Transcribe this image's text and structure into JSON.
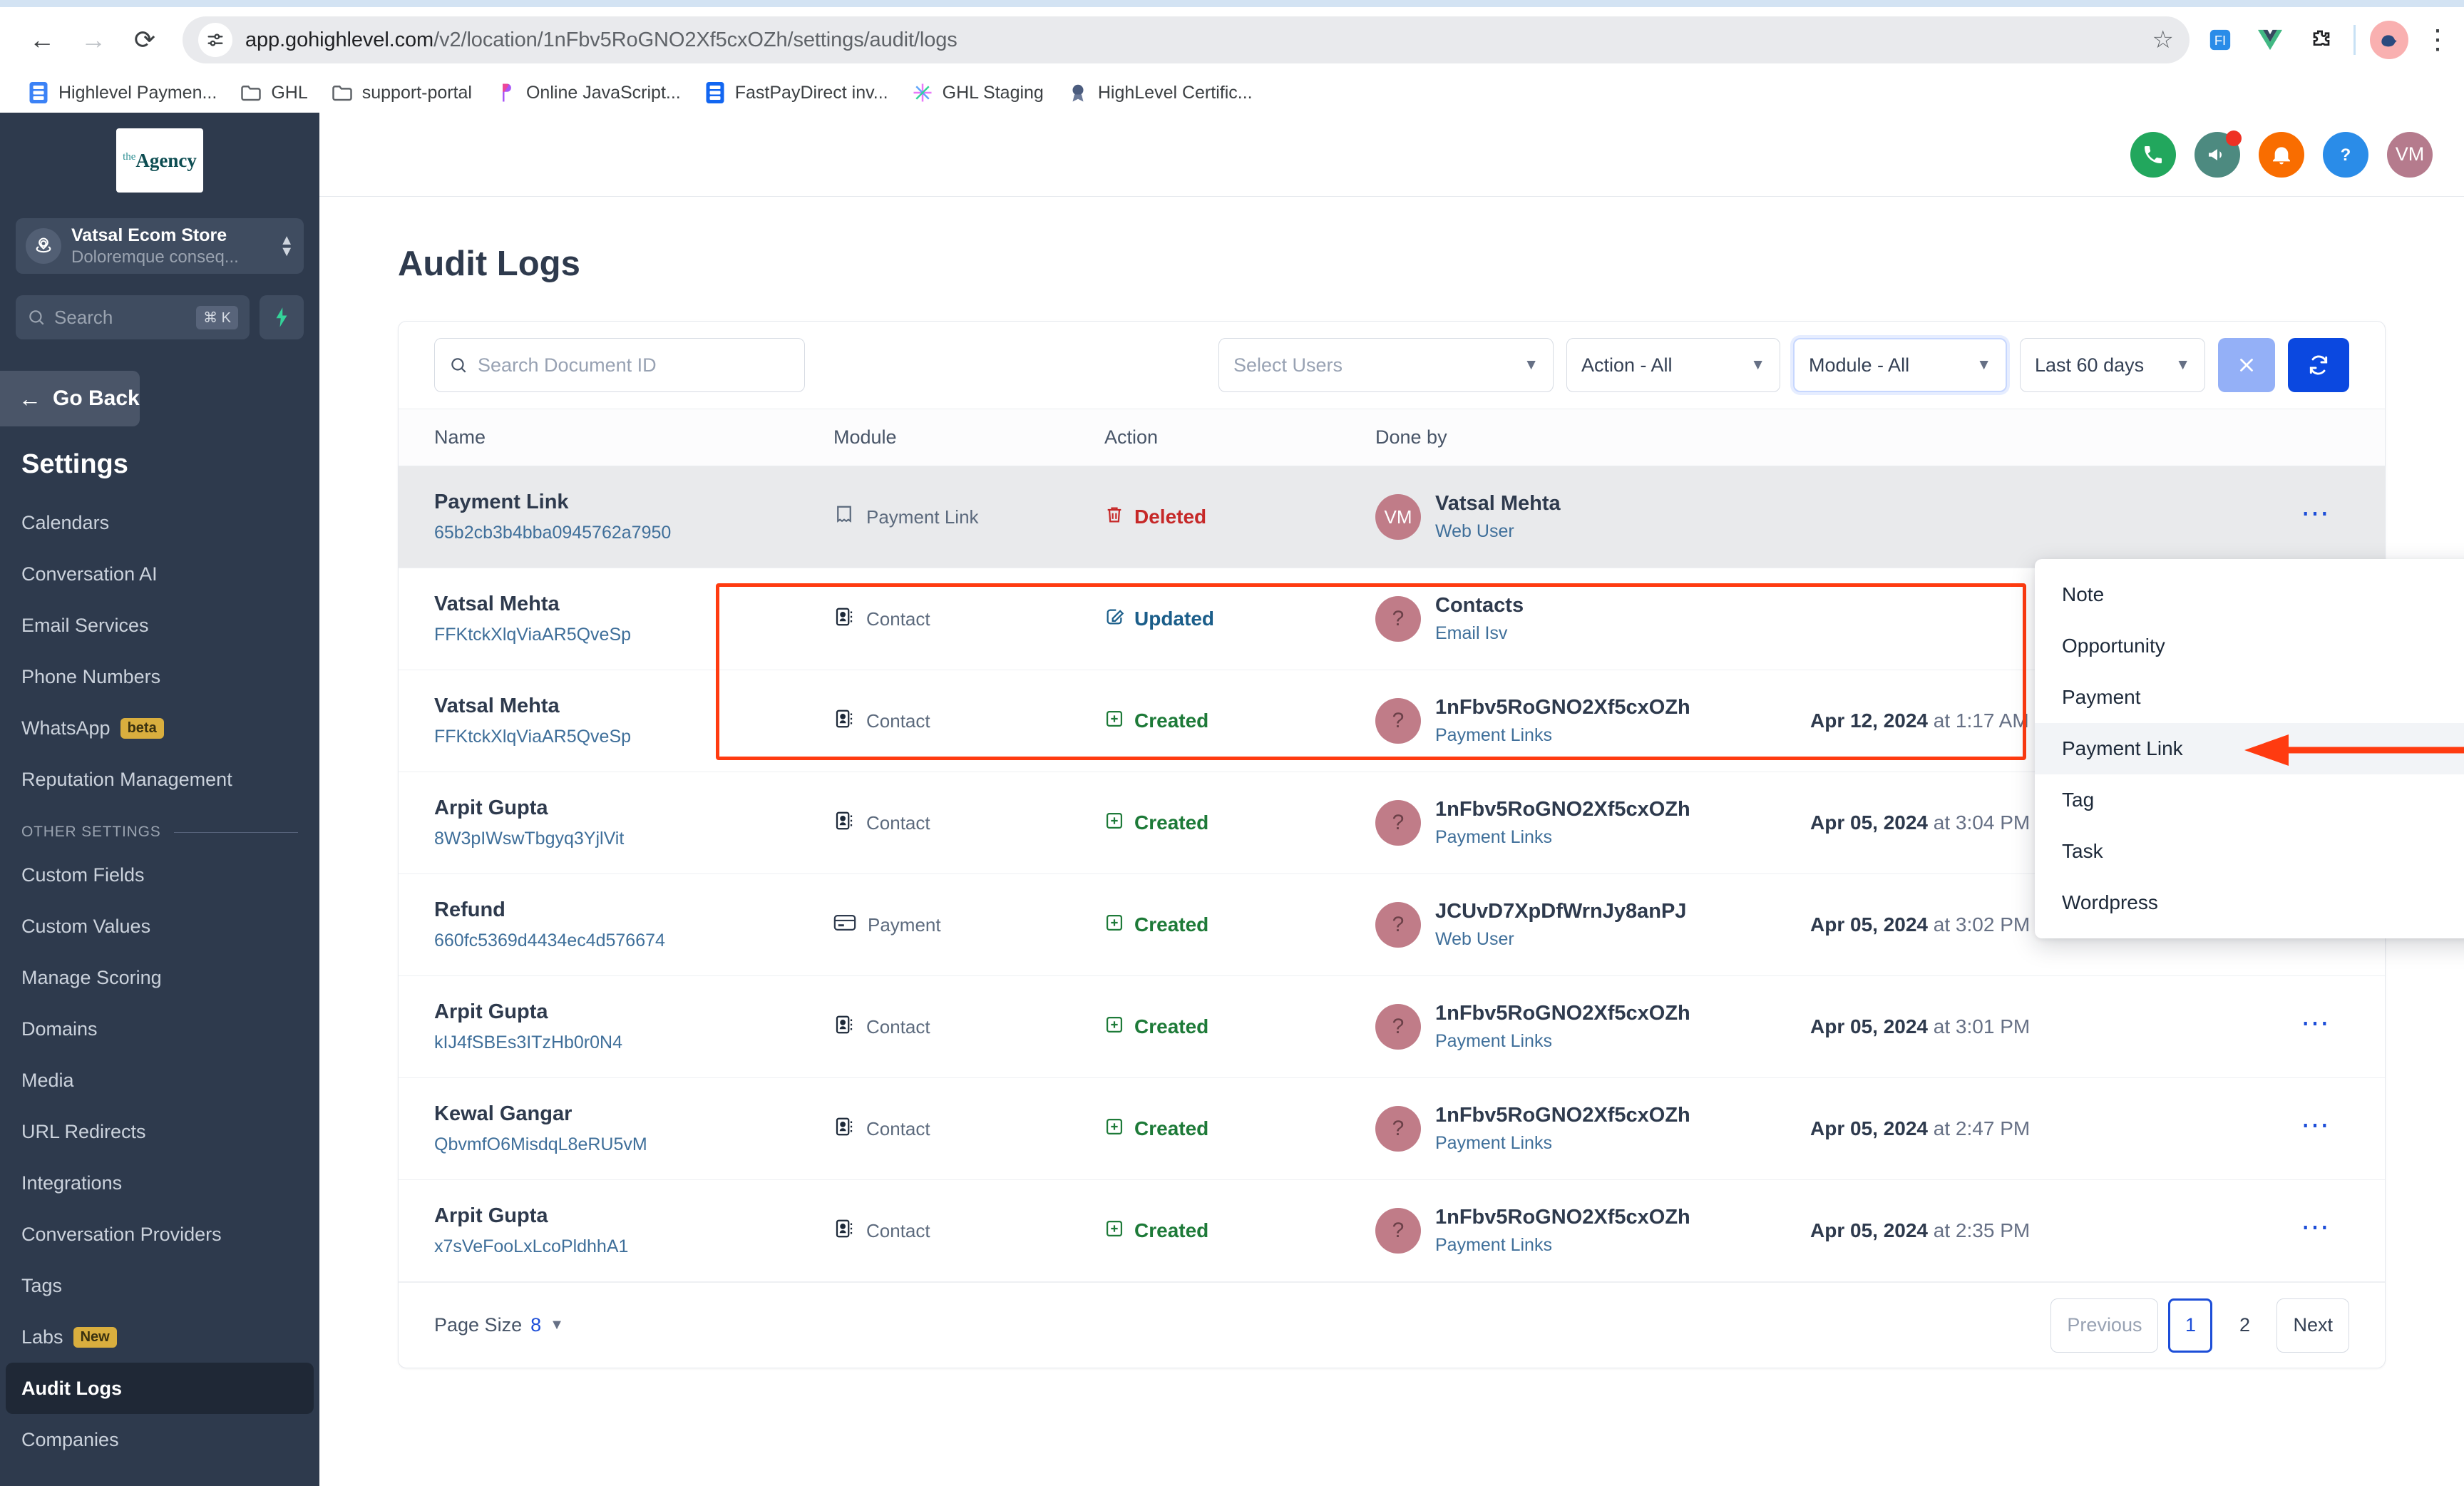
{
  "browser": {
    "back_icon": "back-arrow-icon",
    "forward_icon": "forward-arrow-icon",
    "reload_icon": "reload-icon",
    "url_host": "app.gohighlevel.com",
    "url_path": "/v2/location/1nFbv5RoGNO2Xf5cxOZh/settings/audit/logs",
    "bookmarks": [
      {
        "label": "Highlevel Paymen...",
        "icon": "blue-list-icon"
      },
      {
        "label": "GHL",
        "icon": "folder-icon"
      },
      {
        "label": "support-portal",
        "icon": "folder-icon"
      },
      {
        "label": "Online JavaScript...",
        "icon": "purple-p-icon"
      },
      {
        "label": "FastPayDirect inv...",
        "icon": "blue-list-icon"
      },
      {
        "label": "GHL Staging",
        "icon": "sparkle-icon"
      },
      {
        "label": "HighLevel Certific...",
        "icon": "badge-icon"
      }
    ]
  },
  "sidebar": {
    "logo_the": "the",
    "logo_name": "Agency",
    "location_name": "Vatsal Ecom Store",
    "location_subtitle": "Doloremque conseq...",
    "search_placeholder": "Search",
    "search_shortcut": "⌘ K",
    "go_back_label": "Go Back",
    "settings_heading": "Settings",
    "items": [
      {
        "label": "Calendars"
      },
      {
        "label": "Conversation AI"
      },
      {
        "label": "Email Services"
      },
      {
        "label": "Phone Numbers"
      },
      {
        "label": "WhatsApp",
        "badge": "beta"
      },
      {
        "label": "Reputation Management"
      }
    ],
    "other_section_label": "OTHER SETTINGS",
    "other_items": [
      {
        "label": "Custom Fields"
      },
      {
        "label": "Custom Values"
      },
      {
        "label": "Manage Scoring"
      },
      {
        "label": "Domains"
      },
      {
        "label": "Media"
      },
      {
        "label": "URL Redirects"
      },
      {
        "label": "Integrations"
      },
      {
        "label": "Conversation Providers"
      },
      {
        "label": "Tags"
      },
      {
        "label": "Labs",
        "badge": "New"
      },
      {
        "label": "Audit Logs",
        "active": true
      },
      {
        "label": "Companies"
      }
    ]
  },
  "topbar": {
    "icons": [
      {
        "name": "phone-icon",
        "color": "#22a75d"
      },
      {
        "name": "megaphone-icon",
        "color": "#4d8a80",
        "dot": true
      },
      {
        "name": "bell-icon",
        "color": "#f96d00"
      },
      {
        "name": "help-icon",
        "color": "#2a8ce8"
      }
    ],
    "avatar_initials": "VM",
    "avatar_color": "#b57b8d"
  },
  "page": {
    "title": "Audit Logs"
  },
  "filters": {
    "search_placeholder": "Search Document ID",
    "users_placeholder": "Select Users",
    "action_value": "Action - All",
    "module_value": "Module - All",
    "date_value": "Last 60 days",
    "clear_icon": "close-icon",
    "refresh_icon": "refresh-icon"
  },
  "module_dropdown": {
    "options": [
      {
        "label": "Note"
      },
      {
        "label": "Opportunity"
      },
      {
        "label": "Payment"
      },
      {
        "label": "Payment Link",
        "hovered": true
      },
      {
        "label": "Tag"
      },
      {
        "label": "Task"
      },
      {
        "label": "Wordpress"
      }
    ]
  },
  "table": {
    "columns": [
      "Name",
      "Module",
      "Action",
      "Done by",
      "",
      ""
    ],
    "rows": [
      {
        "name": "Payment Link",
        "doc_id": "65b2cb3b4bba0945762a7950",
        "module": "Payment Link",
        "module_icon": "receipt-icon",
        "action": "Deleted",
        "action_type": "deleted",
        "done_by": "Vatsal Mehta",
        "done_by_sub": "Web User",
        "avatar": "VM",
        "date": "",
        "time": "",
        "highlight": true
      },
      {
        "name": "Vatsal Mehta",
        "doc_id": "FFKtckXlqViaAR5QveSp",
        "module": "Contact",
        "module_icon": "contact-card-icon",
        "action": "Updated",
        "action_type": "updated",
        "done_by": "Contacts",
        "done_by_sub": "Email Isv",
        "avatar": "?",
        "date": "",
        "time": ""
      },
      {
        "name": "Vatsal Mehta",
        "doc_id": "FFKtckXlqViaAR5QveSp",
        "module": "Contact",
        "module_icon": "contact-card-icon",
        "action": "Created",
        "action_type": "created",
        "done_by": "1nFbv5RoGNO2Xf5cxOZh",
        "done_by_sub": "Payment Links",
        "avatar": "?",
        "date": "Apr 12, 2024",
        "time": "at 1:17 AM"
      },
      {
        "name": "Arpit Gupta",
        "doc_id": "8W3pIWswTbgyq3YjlVit",
        "module": "Contact",
        "module_icon": "contact-card-icon",
        "action": "Created",
        "action_type": "created",
        "done_by": "1nFbv5RoGNO2Xf5cxOZh",
        "done_by_sub": "Payment Links",
        "avatar": "?",
        "date": "Apr 05, 2024",
        "time": "at 3:04 PM"
      },
      {
        "name": "Refund",
        "doc_id": "660fc5369d4434ec4d576674",
        "module": "Payment",
        "module_icon": "credit-card-icon",
        "action": "Created",
        "action_type": "created",
        "done_by": "JCUvD7XpDfWrnJy8anPJ",
        "done_by_sub": "Web User",
        "avatar": "?",
        "date": "Apr 05, 2024",
        "time": "at 3:02 PM"
      },
      {
        "name": "Arpit Gupta",
        "doc_id": "kIJ4fSBEs3ITzHb0r0N4",
        "module": "Contact",
        "module_icon": "contact-card-icon",
        "action": "Created",
        "action_type": "created",
        "done_by": "1nFbv5RoGNO2Xf5cxOZh",
        "done_by_sub": "Payment Links",
        "avatar": "?",
        "date": "Apr 05, 2024",
        "time": "at 3:01 PM"
      },
      {
        "name": "Kewal Gangar",
        "doc_id": "QbvmfO6MisdqL8eRU5vM",
        "module": "Contact",
        "module_icon": "contact-card-icon",
        "action": "Created",
        "action_type": "created",
        "done_by": "1nFbv5RoGNO2Xf5cxOZh",
        "done_by_sub": "Payment Links",
        "avatar": "?",
        "date": "Apr 05, 2024",
        "time": "at 2:47 PM"
      },
      {
        "name": "Arpit Gupta",
        "doc_id": "x7sVeFooLxLcoPldhhA1",
        "module": "Contact",
        "module_icon": "contact-card-icon",
        "action": "Created",
        "action_type": "created",
        "done_by": "1nFbv5RoGNO2Xf5cxOZh",
        "done_by_sub": "Payment Links",
        "avatar": "?",
        "date": "Apr 05, 2024",
        "time": "at 2:35 PM"
      }
    ]
  },
  "footer": {
    "page_size_label": "Page Size",
    "page_size_value": "8",
    "previous_label": "Previous",
    "pages": [
      "1",
      "2"
    ],
    "current_page": "1",
    "next_label": "Next"
  },
  "colors": {
    "sidebar_bg": "#2e3a4d",
    "accent_blue": "#0b48e0",
    "deleted_red": "#c62828",
    "created_green": "#1d7a38",
    "updated_blue": "#1b5e8a",
    "annotation_red": "#ff3b10"
  }
}
